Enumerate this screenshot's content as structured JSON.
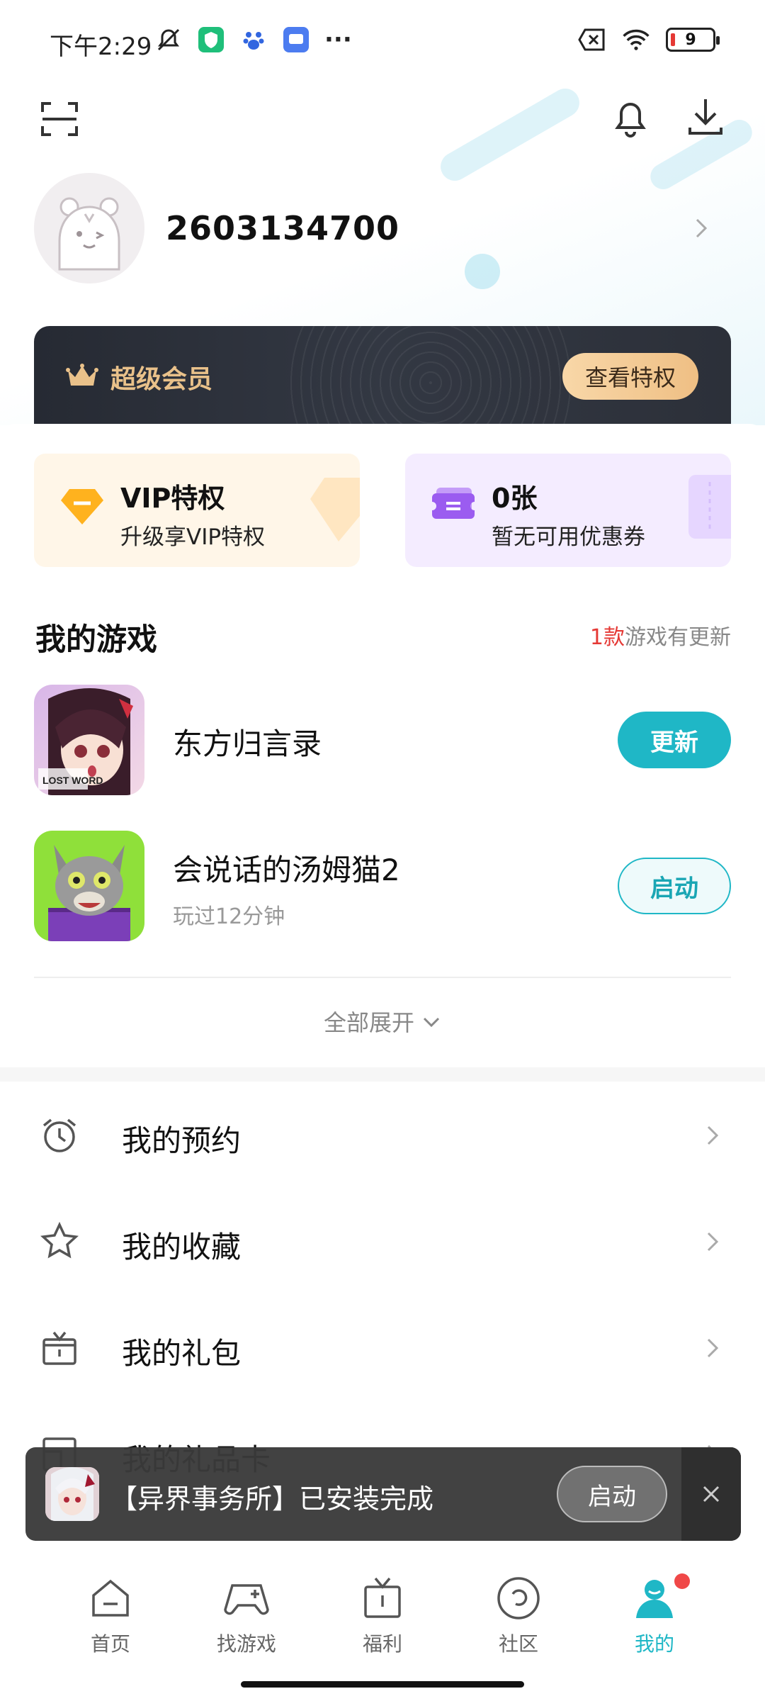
{
  "status_bar": {
    "time": "下午2:29",
    "more": "···",
    "battery_level": "9"
  },
  "profile": {
    "username": "2603134700"
  },
  "vip_banner": {
    "label": "超级会员",
    "button": "查看特权"
  },
  "cards": {
    "vip": {
      "title": "VIP特权",
      "subtitle": "升级享VIP特权"
    },
    "coupon": {
      "title": "0张",
      "subtitle": "暂无可用优惠券"
    }
  },
  "my_games": {
    "title": "我的游戏",
    "update_count": "1款",
    "update_note": "游戏有更新",
    "games": [
      {
        "name": "东方归言录",
        "subtitle": "",
        "action": "更新"
      },
      {
        "name": "会说话的汤姆猫2",
        "subtitle": "玩过12分钟",
        "action": "启动"
      }
    ],
    "expand_label": "全部展开"
  },
  "menu": [
    {
      "label": "我的预约",
      "icon": "alarm-clock-icon"
    },
    {
      "label": "我的收藏",
      "icon": "star-icon"
    },
    {
      "label": "我的礼包",
      "icon": "gift-icon"
    },
    {
      "label": "我的礼品卡",
      "icon": "gift-card-icon"
    }
  ],
  "toast": {
    "text": "【异界事务所】已安装完成",
    "button": "启动"
  },
  "bottom_nav": [
    {
      "label": "首页",
      "icon": "home-icon"
    },
    {
      "label": "找游戏",
      "icon": "gamepad-icon"
    },
    {
      "label": "福利",
      "icon": "gift-icon"
    },
    {
      "label": "社区",
      "icon": "community-icon"
    },
    {
      "label": "我的",
      "icon": "profile-icon",
      "active": true
    }
  ],
  "colors": {
    "accent": "#1fb7c6",
    "highlight": "#e53935",
    "vip_gold": "#e9c18a"
  }
}
